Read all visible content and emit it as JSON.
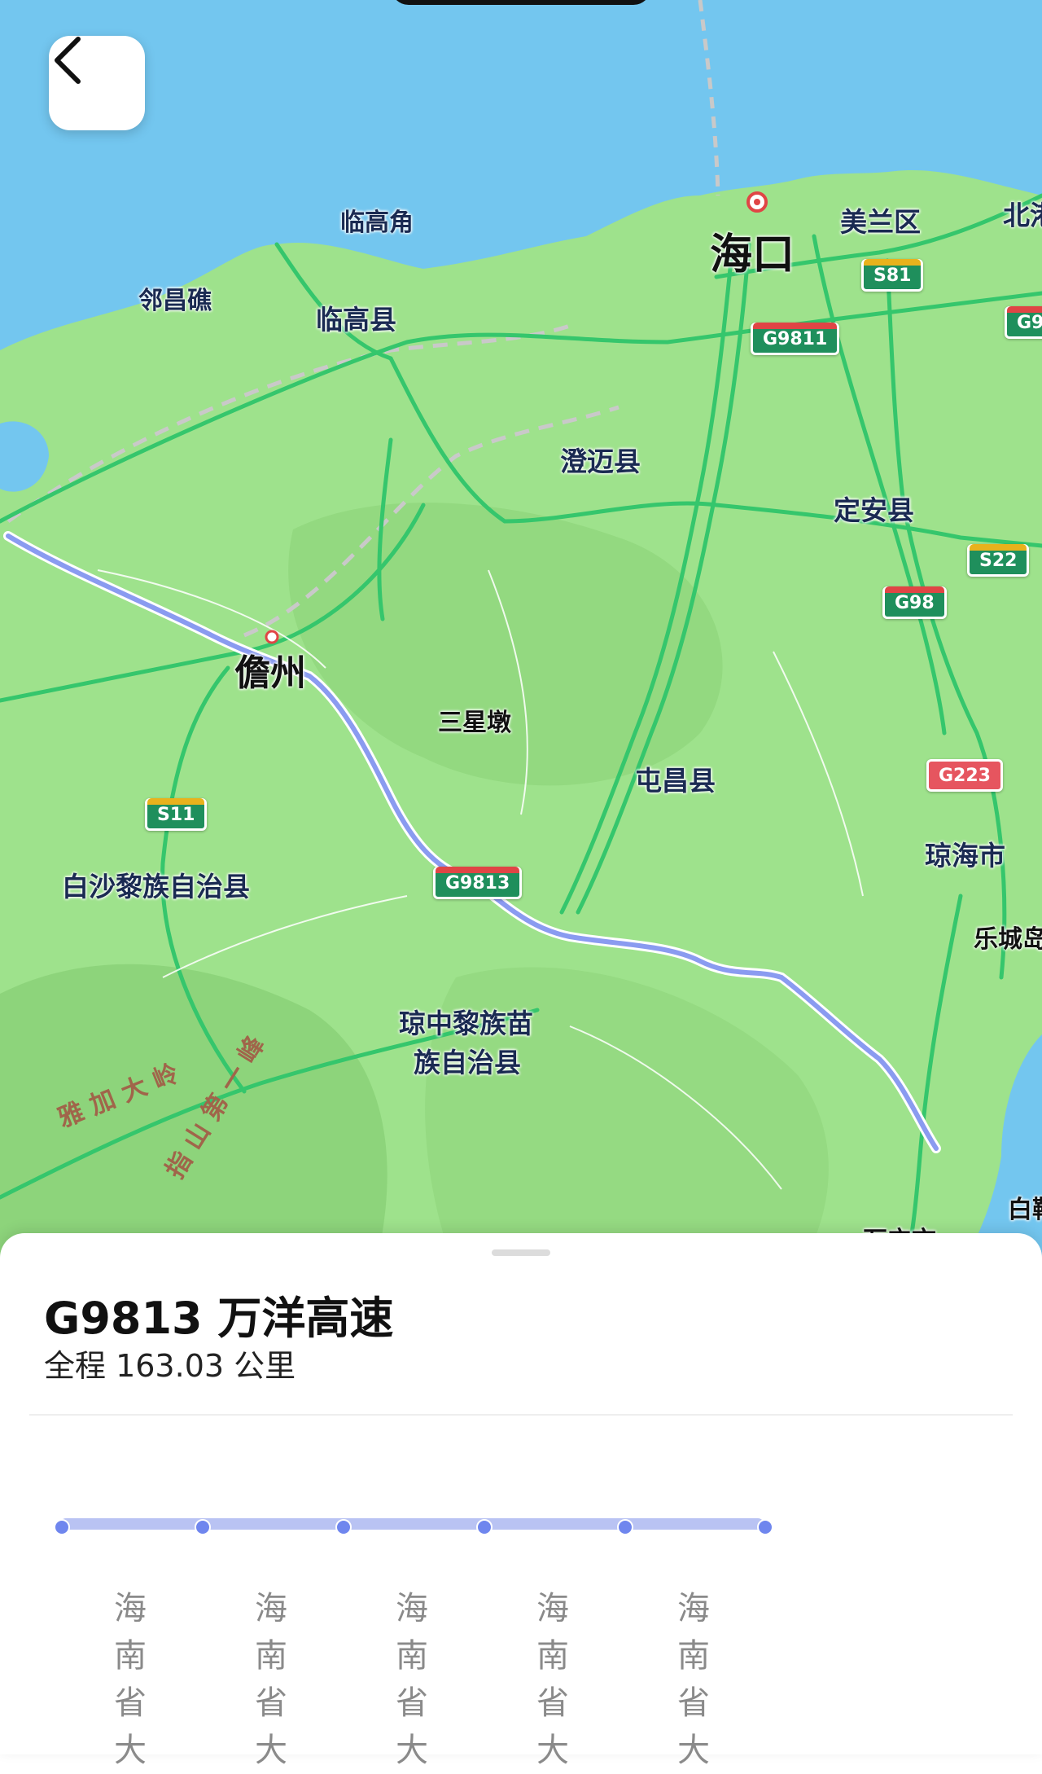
{
  "map": {
    "places": {
      "haikou": "海口",
      "meilan": "美兰区",
      "beigang": "北港",
      "lingaojiao": "临高角",
      "linchangjiao": "邻昌礁",
      "lingao": "临高县",
      "chengmai": "澄迈县",
      "dingan": "定安县",
      "danzhou": "儋州",
      "sanxingdun": "三星墩",
      "tunchang": "屯昌县",
      "baisha": "白沙黎族自治县",
      "qionghai": "琼海市",
      "lecheng": "乐城岛",
      "qiongzhong_1": "琼中黎族苗",
      "qiongzhong_2": "族自治县",
      "yajia": "雅 加 大 岭",
      "wuzhi": "指 山 第 一 峰",
      "bai": "白鞘",
      "wanning": "万宁市"
    },
    "shields": {
      "s81": "S81",
      "g9811": "G9811",
      "g98a": "G98",
      "g98b": "G98",
      "s22": "S22",
      "g223": "G223",
      "s11": "S11",
      "g9813": "G9813"
    },
    "colors": {
      "sea": "#73c6ef",
      "land": "#9ee28c",
      "road": "#35c66c",
      "route": "#8a9bf0"
    }
  },
  "route": {
    "title": "G9813 万洋高速",
    "distance": "全程 163.03 公里"
  },
  "segments": [
    {
      "chars": [
        "海",
        "南",
        "省",
        "大"
      ]
    },
    {
      "chars": [
        "海",
        "南",
        "省",
        "大"
      ]
    },
    {
      "chars": [
        "海",
        "南",
        "省",
        "大"
      ]
    },
    {
      "chars": [
        "海",
        "南",
        "省",
        "大"
      ]
    },
    {
      "chars": [
        "海",
        "南",
        "省",
        "大"
      ]
    }
  ],
  "icons": {
    "back": "chevron-left-icon"
  }
}
